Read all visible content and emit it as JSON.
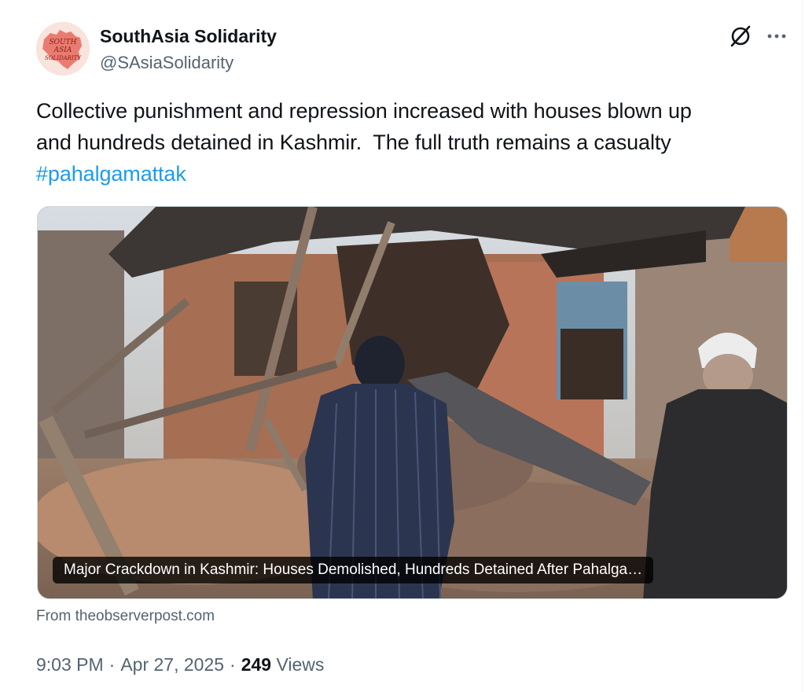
{
  "author": {
    "display_name": "SouthAsia Solidarity",
    "handle": "@SAsiaSolidarity",
    "avatar_logo_text": "SOUTH ASIA SOLIDARITY",
    "avatar_color": "#e2574c"
  },
  "header_icons": {
    "grok": "grok-slash-circle-icon",
    "more": "more-ellipsis-icon"
  },
  "tweet": {
    "text_line_1": "Collective punishment and repression increased with houses blown up",
    "text_line_2": "and hundreds detained in Kashmir.  The full truth remains a casualty",
    "hashtag": "#pahalgamattak"
  },
  "media": {
    "caption": "Major Crackdown in Kashmir: Houses Demolished, Hundreds Detained After Pahalga…",
    "source": "From theobserverpost.com"
  },
  "meta": {
    "time": "9:03 PM",
    "separator": "·",
    "date": "Apr 27, 2025",
    "views_count": "249",
    "views_label": "Views"
  },
  "colors": {
    "text": "#0f1419",
    "secondary": "#536471",
    "link": "#1d9bf0",
    "border": "#cfd9de"
  }
}
